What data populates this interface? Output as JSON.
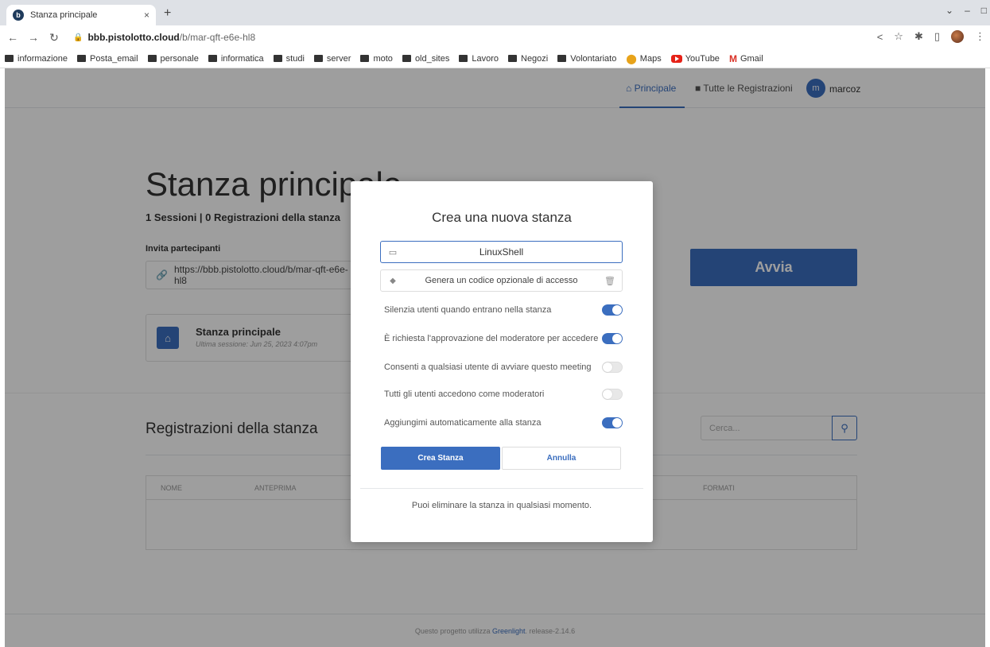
{
  "browser": {
    "tab_title": "Stanza principale",
    "tab_close": "×",
    "new_tab": "+",
    "url_host": "bbb.pistolotto.cloud",
    "url_path": "/b/mar-qft-e6e-hl8",
    "bookmarks": [
      "informazione",
      "Posta_email",
      "personale",
      "informatica",
      "studi",
      "server",
      "moto",
      "old_sites",
      "Lavoro",
      "Negozi",
      "Volontariato",
      "Maps",
      "YouTube",
      "Gmail"
    ]
  },
  "nav": {
    "home": "Principale",
    "recordings": "Tutte le Registrazioni",
    "avatar_initial": "m",
    "username": "marcoz"
  },
  "room": {
    "title": "Stanza principale",
    "stats": "1 Sessioni | 0 Registrazioni della stanza",
    "invite_label": "Invita partecipanti",
    "invite_url": "https://bbb.pistolotto.cloud/b/mar-qft-e6e-hl8",
    "start_button": "Avvia",
    "card_name": "Stanza principale",
    "card_last_session": "Ultima sessione: Jun 25, 2023 4:07pm"
  },
  "recordings": {
    "title": "Registrazioni della stanza",
    "search_placeholder": "Cerca...",
    "columns": [
      "NOME",
      "ANTEPRIMA",
      "FORMATI"
    ]
  },
  "footer": {
    "prefix": "Questo progetto utilizza ",
    "link": "Greenlight",
    "suffix": ". release-2.14.6"
  },
  "modal": {
    "title": "Crea una nuova stanza",
    "room_name_value": "LinuxShell",
    "access_code_text": "Genera un codice opzionale di accesso",
    "options": [
      {
        "label": "Silenzia utenti quando entrano nella stanza",
        "on": true
      },
      {
        "label": "È richiesta l'approvazione del moderatore per accedere",
        "on": true
      },
      {
        "label": "Consenti a qualsiasi utente di avviare questo meeting",
        "on": false
      },
      {
        "label": "Tutti gli utenti accedono come moderatori",
        "on": false
      },
      {
        "label": "Aggiungimi automaticamente alla stanza",
        "on": true
      }
    ],
    "create_button": "Crea Stanza",
    "cancel_button": "Annulla",
    "footer_note": "Puoi eliminare la stanza in qualsiasi momento."
  },
  "colors": {
    "accent": "#3b6ebf"
  }
}
